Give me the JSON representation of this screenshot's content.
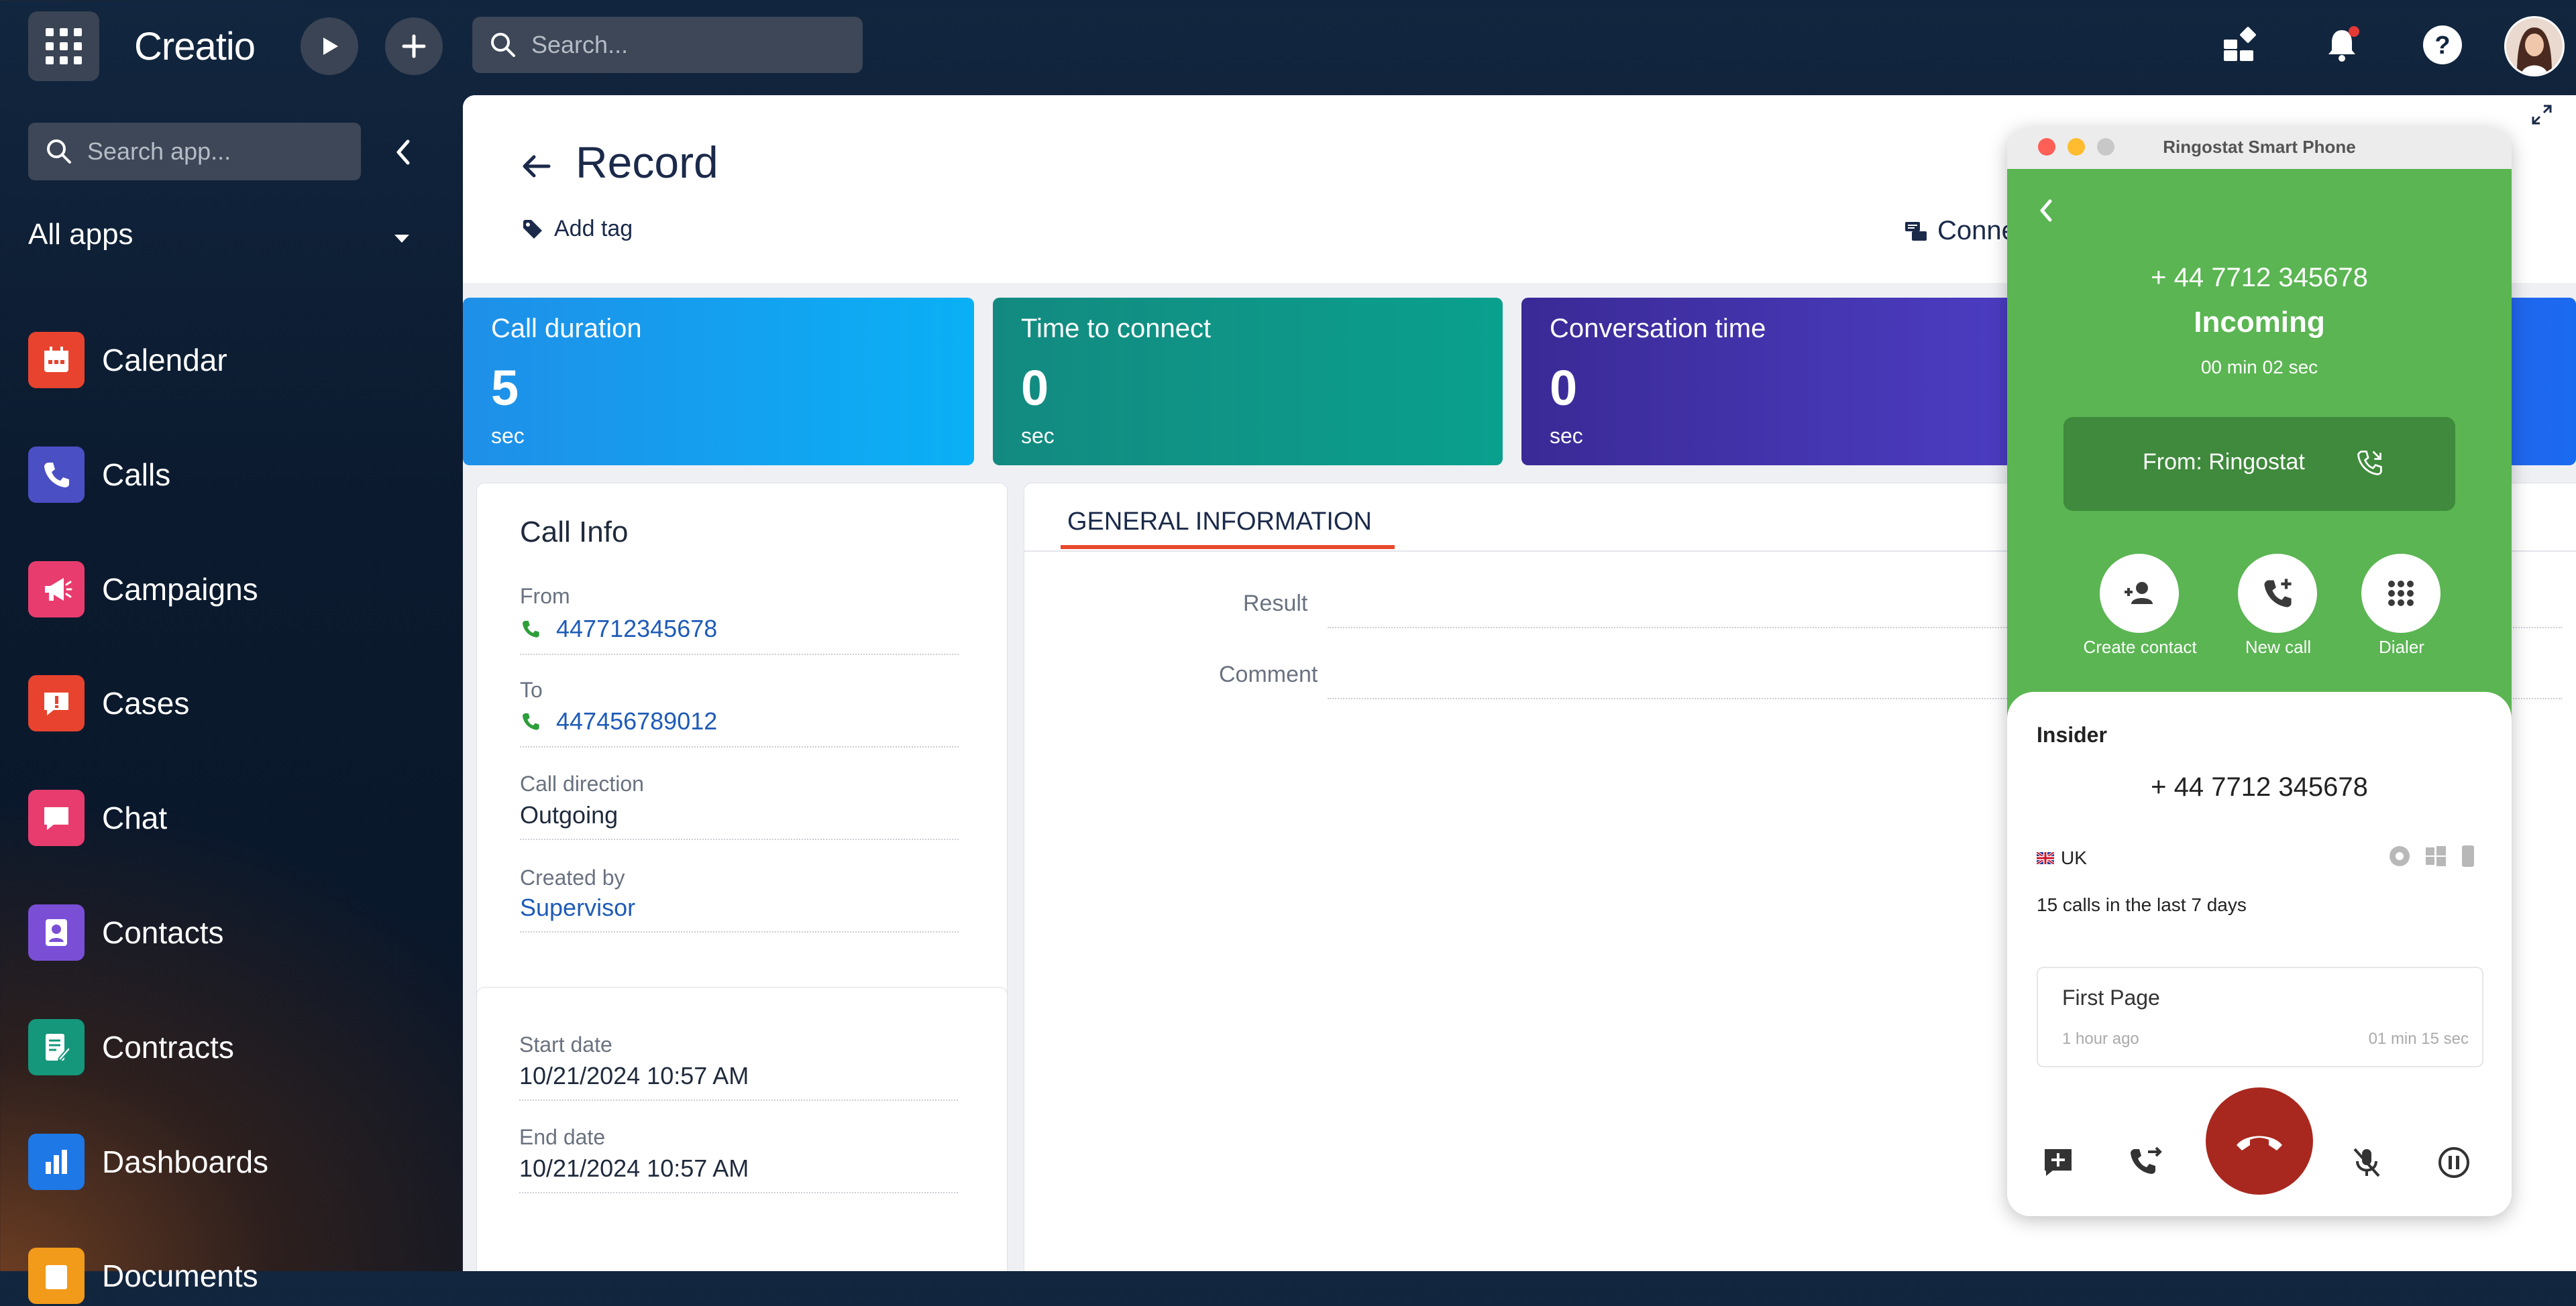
{
  "topbar": {
    "logo": "Creatio",
    "search_placeholder": "Search..."
  },
  "sidebar": {
    "search_placeholder": "Search app...",
    "section_label": "All apps",
    "items": [
      {
        "label": "Calendar",
        "color": "#e8432e"
      },
      {
        "label": "Calls",
        "color": "#4b4fc4"
      },
      {
        "label": "Campaigns",
        "color": "#e83c6e"
      },
      {
        "label": "Cases",
        "color": "#e8432e"
      },
      {
        "label": "Chat",
        "color": "#e83c6e"
      },
      {
        "label": "Contacts",
        "color": "#7a4fd6"
      },
      {
        "label": "Contracts",
        "color": "#14977b"
      },
      {
        "label": "Dashboards",
        "color": "#1e78e6"
      },
      {
        "label": "Documents",
        "color": "#f29a1a"
      }
    ]
  },
  "record": {
    "title": "Record",
    "add_tag": "Add tag",
    "connect": "Conne"
  },
  "tiles": [
    {
      "label": "Call duration",
      "value": "5",
      "unit": "sec",
      "color": "#0aa1f0"
    },
    {
      "label": "Time to connect",
      "value": "0",
      "unit": "sec",
      "color": "#0f9488"
    },
    {
      "label": "Conversation time",
      "value": "0",
      "unit": "sec",
      "color": "#3e2fa0"
    }
  ],
  "call_info": {
    "title": "Call Info",
    "from_label": "From",
    "from_value": "447712345678",
    "to_label": "To",
    "to_value": "447456789012",
    "direction_label": "Call direction",
    "direction_value": "Outgoing",
    "created_label": "Created by",
    "created_value": "Supervisor"
  },
  "dates": {
    "start_label": "Start date",
    "start_value": "10/21/2024 10:57 AM",
    "end_label": "End date",
    "end_value": "10/21/2024 10:57 AM"
  },
  "general": {
    "tab": "GENERAL INFORMATION",
    "result_label": "Result",
    "comment_label": "Comment"
  },
  "phone": {
    "window_title": "Ringostat Smart Phone",
    "number": "+ 44 7712 345678",
    "status": "Incoming",
    "timer": "00 min 02 sec",
    "from": "From: Ringostat",
    "actions": [
      "Create contact",
      "New call",
      "Dialer"
    ],
    "contact_tag": "Insider",
    "contact_number": "+ 44 7712 345678",
    "country": "UK",
    "calls_summary": "15 calls in the last 7 days",
    "page_title": "First Page",
    "page_when": "1 hour ago",
    "page_duration": "01 min 15 sec"
  }
}
